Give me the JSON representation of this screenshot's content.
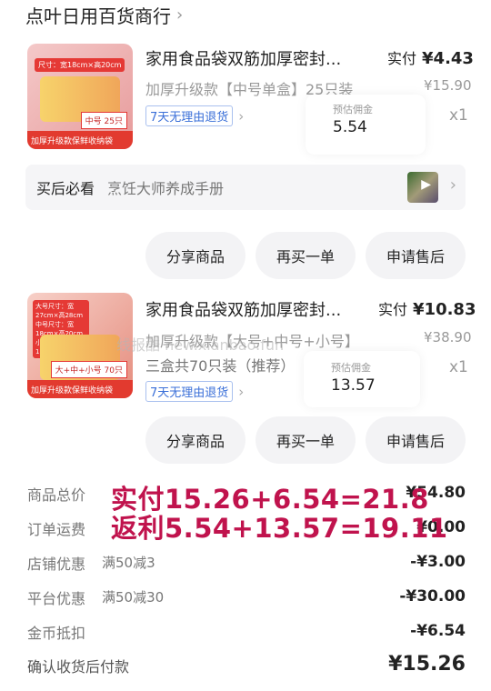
{
  "store": {
    "name": "点叶日用百货商行",
    "chevron_icon": "chevron-right-icon"
  },
  "items": [
    {
      "thumb": {
        "size_label": "尺寸：宽18cm×高20cm",
        "stripe": "加厚升级款保鲜收纳袋",
        "count": "中号 25只"
      },
      "title": "家用食品袋双筋加厚密封...",
      "spec": "加厚升级款【中号单盒】25只装",
      "spec2": "",
      "tag": "7天无理由退货",
      "paid_label": "实付",
      "paid_amount": "¥4.43",
      "orig_price": "¥15.90",
      "quantity": "x1",
      "est_label": "预估佣金",
      "est_value": "5.54"
    },
    {
      "thumb": {
        "size_label": "大号尺寸：宽27cm×高28cm 中号尺寸：宽18cm×高20cm 小号尺寸：宽16cm×高14cm",
        "stripe": "加厚升级款保鲜收纳袋",
        "count": "大+中+小号 70只"
      },
      "title": "家用食品袋双筋加厚密封...",
      "spec": "加厚升级款【大号+中号+小号】",
      "spec2": "三盒共70只装（推荐）",
      "tag": "7天无理由退货",
      "paid_label": "实付",
      "paid_amount": "¥10.83",
      "orig_price": "¥38.90",
      "quantity": "x1",
      "est_label": "预估佣金",
      "est_value": "13.57"
    }
  ],
  "after_sales_bar": {
    "label": "买后必看",
    "value": "烹饪大师养成手册",
    "video_icon": "play-icon"
  },
  "buttons": {
    "share": "分享商品",
    "rebuy": "再买一单",
    "after_sale": "申请售后"
  },
  "summary": [
    {
      "label": "商品总价",
      "sub": "",
      "value": "¥54.80"
    },
    {
      "label": "订单运费",
      "sub": "",
      "value": "¥0.00"
    },
    {
      "label": "店铺优惠",
      "sub": "满50减3",
      "value": "-¥3.00"
    },
    {
      "label": "平台优惠",
      "sub": "满50减30",
      "value": "-¥30.00"
    },
    {
      "label": "金币抵扣",
      "sub": "",
      "value": "-¥6.54"
    }
  ],
  "total": {
    "label": "确认收货后付款",
    "value": "¥15.26"
  },
  "annotations": {
    "line1": "实付15.26+6.54=21.8",
    "line2": "返利5.54+13.57=19.11"
  },
  "watermark": "线报酷 new.xianbao.fun",
  "colors": {
    "annotation": "#c0134d",
    "tag_blue": "#3a6fd8",
    "button_bg": "#f3f3f5"
  }
}
